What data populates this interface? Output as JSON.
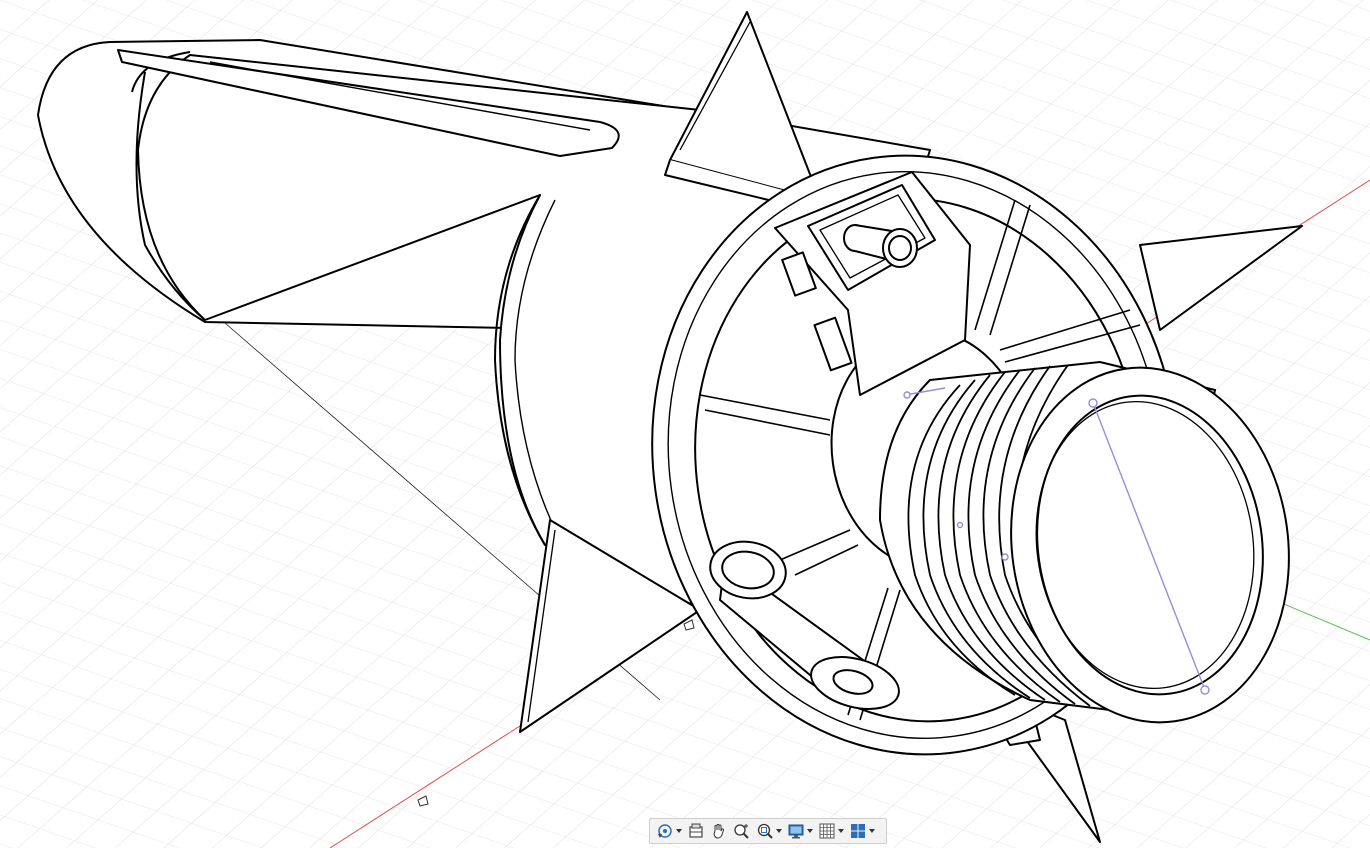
{
  "viewport": {
    "model": "rocket-engine-assembly",
    "visual_style": "hidden-line",
    "axis_colors": {
      "x": "#e05050",
      "y": "#50c050",
      "selection": "#9a8ad8"
    },
    "line_color": "#000000",
    "grid_color": "#cfcfcf"
  },
  "nav_toolbar": {
    "items": [
      {
        "id": "orbit",
        "icon": "orbit-icon",
        "has_menu": true
      },
      {
        "id": "walk",
        "icon": "walk-icon",
        "has_menu": false
      },
      {
        "id": "pan",
        "icon": "hand-pan-icon",
        "has_menu": false
      },
      {
        "id": "zoom",
        "icon": "zoom-plus-icon",
        "has_menu": false
      },
      {
        "id": "zoom-window",
        "icon": "zoom-window-icon",
        "has_menu": true
      },
      {
        "id": "display",
        "icon": "monitor-icon",
        "has_menu": true
      },
      {
        "id": "grid",
        "icon": "grid-icon",
        "has_menu": true
      },
      {
        "id": "viewports",
        "icon": "viewports-icon",
        "has_menu": true
      }
    ]
  }
}
